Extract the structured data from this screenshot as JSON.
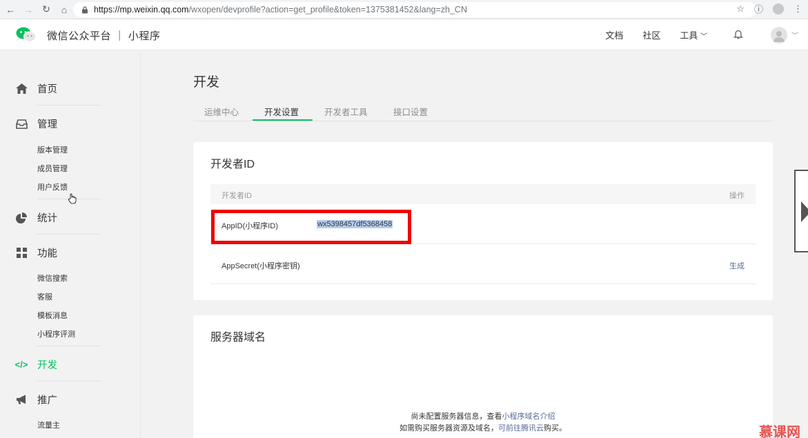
{
  "browser": {
    "url_host": "https://mp.weixin.qq.com",
    "url_path": "/wxopen/devprofile?action=get_profile&token=1375381452&lang=zh_CN"
  },
  "header": {
    "site_title": "微信公众平台 ｜ 小程序",
    "nav": {
      "docs": "文档",
      "community": "社区",
      "tools": "工具"
    }
  },
  "sidebar": {
    "home": "首页",
    "manage": "管理",
    "manage_items": [
      "版本管理",
      "成员管理",
      "用户反馈"
    ],
    "stats": "统计",
    "features": "功能",
    "feature_items": [
      "微信搜索",
      "客服",
      "模板消息",
      "小程序评测"
    ],
    "develop": "开发",
    "promote": "推广",
    "promote_items": [
      "流量主"
    ]
  },
  "main": {
    "title": "开发",
    "tabs": [
      "运维中心",
      "开发设置",
      "开发者工具",
      "接口设置"
    ],
    "active_tab": "开发设置",
    "developer_id": {
      "title": "开发者ID",
      "col_id": "开发者ID",
      "col_action": "操作",
      "appid_label": "AppID(小程序ID)",
      "appid_value": "wx5398457df5368458",
      "secret_label": "AppSecret(小程序密钥)",
      "secret_action": "生成"
    },
    "server_domain": {
      "title": "服务器域名",
      "line1_prefix": "尚未配置服务器信息，查看",
      "line1_link": "小程序域名介绍",
      "line2_prefix": "如需购买服务器资源及域名，",
      "line2_link": "可前往腾讯云",
      "line2_suffix": "购买。"
    }
  },
  "watermark": "慕课网",
  "colors": {
    "accent": "#07c160",
    "link": "#576b95",
    "highlight_border": "#ee0000"
  }
}
